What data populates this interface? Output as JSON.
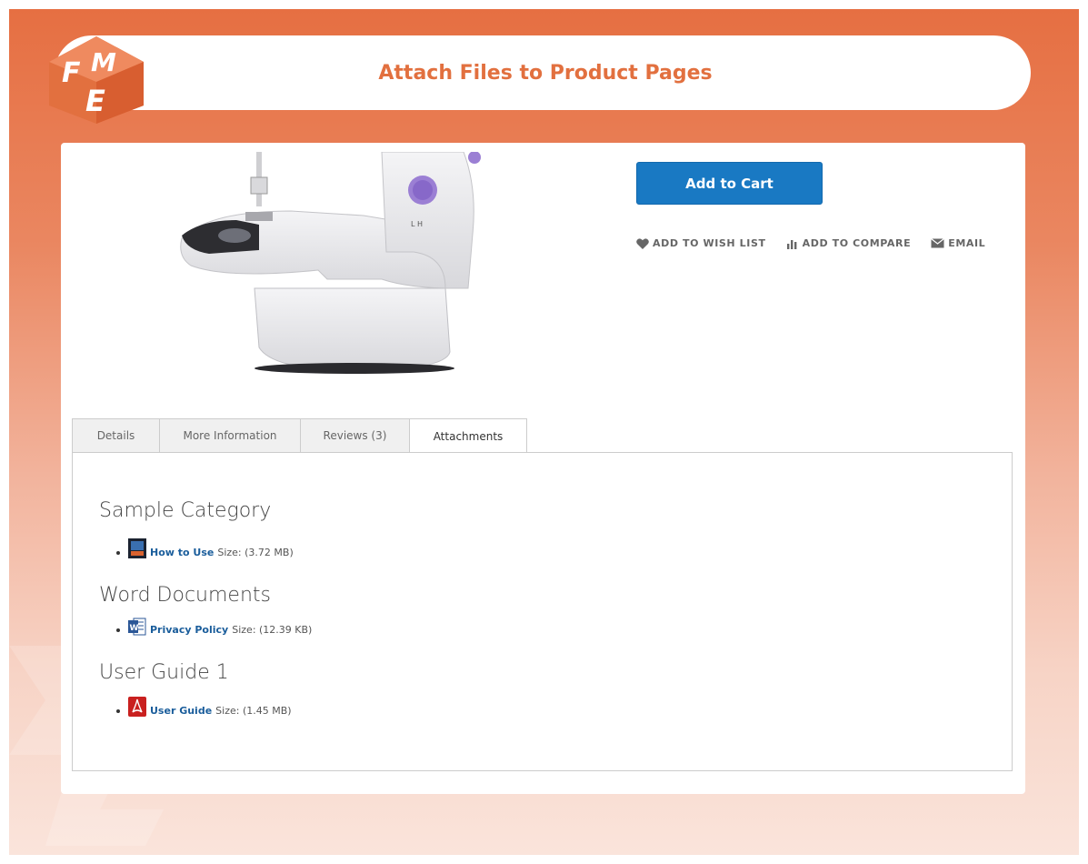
{
  "header": {
    "title": "Attach Files to Product Pages"
  },
  "product": {
    "image_alt": "sewing-machine",
    "add_to_cart_label": "Add to Cart",
    "actions": [
      {
        "label": "ADD TO WISH LIST",
        "icon": "heart-icon"
      },
      {
        "label": "ADD TO COMPARE",
        "icon": "compare-icon"
      },
      {
        "label": "EMAIL",
        "icon": "envelope-icon"
      }
    ]
  },
  "tabs": [
    {
      "label": "Details",
      "active": false
    },
    {
      "label": "More Information",
      "active": false
    },
    {
      "label": "Reviews (3)",
      "active": false
    },
    {
      "label": "Attachments",
      "active": true
    }
  ],
  "attachments": [
    {
      "category": "Sample Category",
      "files": [
        {
          "name": "How to Use",
          "size": "Size: (3.72 MB)",
          "icon": "video-file-icon"
        }
      ]
    },
    {
      "category": "Word Documents",
      "files": [
        {
          "name": "Privacy Policy",
          "size": "Size: (12.39 KB)",
          "icon": "word-file-icon"
        }
      ]
    },
    {
      "category": "User Guide 1",
      "files": [
        {
          "name": "User Guide",
          "size": "Size: (1.45 MB)",
          "icon": "pdf-file-icon"
        }
      ]
    }
  ],
  "colors": {
    "accent": "#e2703f",
    "button": "#1979c3",
    "link": "#1a5d9b"
  }
}
